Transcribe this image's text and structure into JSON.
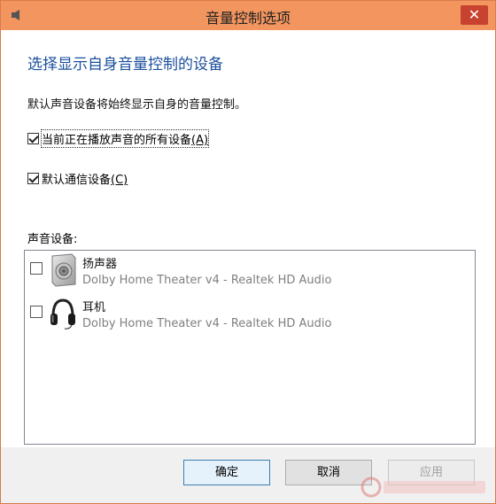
{
  "window": {
    "title": "音量控制选项",
    "close_glyph": "✕"
  },
  "content": {
    "heading": "选择显示自身音量控制的设备",
    "description": "默认声音设备将始终显示自身的音量控制。",
    "options": [
      {
        "label": "当前正在播放声音的所有设备",
        "accel": "(A)",
        "checked": true
      },
      {
        "label": "默认通信设备",
        "accel": "(C)",
        "checked": true
      }
    ],
    "devices_label": "声音设备:",
    "devices": [
      {
        "name": "扬声器",
        "detail": "Dolby Home Theater v4 - Realtek HD Audio",
        "checked": false,
        "icon": "speaker-icon"
      },
      {
        "name": "耳机",
        "detail": "Dolby Home Theater v4 - Realtek HD Audio",
        "checked": false,
        "icon": "headphones-icon"
      }
    ]
  },
  "buttons": {
    "ok": "确定",
    "cancel": "取消",
    "apply": "应用"
  },
  "colors": {
    "titlebar": "#f2955f",
    "close": "#c7422f",
    "heading": "#1a4f9c"
  }
}
